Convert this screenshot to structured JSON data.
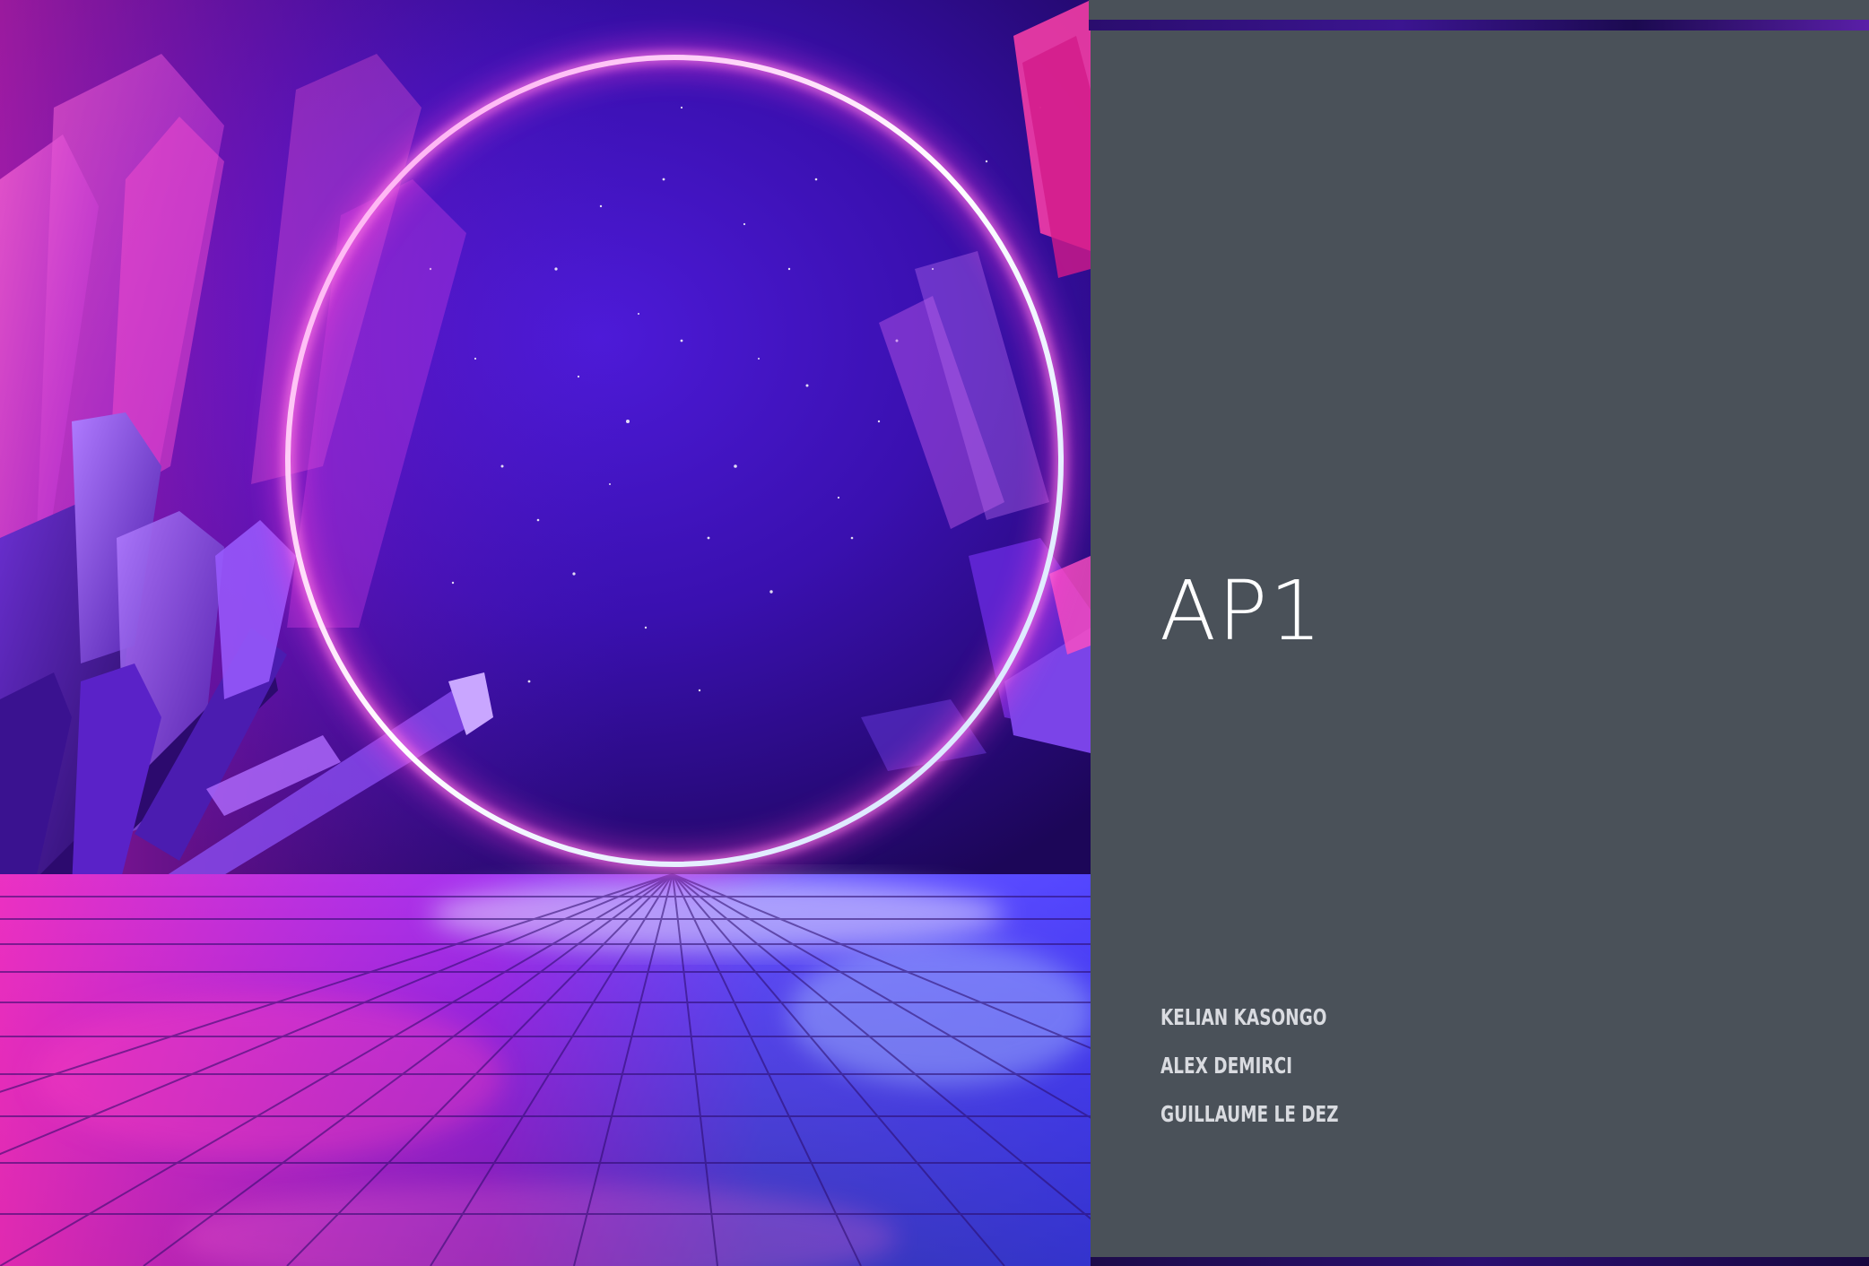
{
  "slide": {
    "title": "AP1",
    "authors": [
      "Kelian Kasongo",
      "Alex Demirci",
      "Guillaume Le Dez"
    ]
  },
  "colors": {
    "panel_background": "#4a5159",
    "title_text": "#ffffff",
    "author_text": "#d9dbe0",
    "neon_ring": "#ffffff",
    "neon_glow_pink": "#ff3bd6",
    "neon_glow_blue": "#5a8bff"
  },
  "artwork": {
    "subject": "neon-ring-crystal-landscape"
  }
}
